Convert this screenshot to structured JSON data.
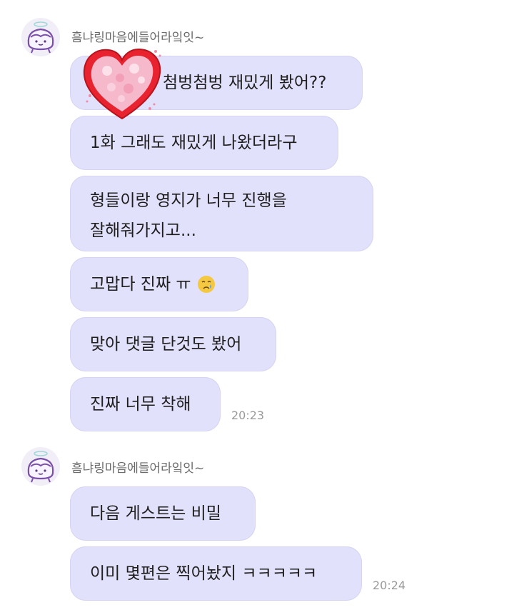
{
  "groups": [
    {
      "sender": "흠냐링마음에들어라잌잇~",
      "messages": [
        {
          "text": "첨벙첨벙 재밌게 봤어??"
        },
        {
          "text": "1화 그래도 재밌게 나왔더라구"
        },
        {
          "lines": [
            "형들이랑 영지가 너무 진행을",
            "잘해줘가지고..."
          ]
        },
        {
          "text": "고맙다 진짜 ㅠ",
          "emoji": "crying-face-icon"
        },
        {
          "text": "맞아 댓글 단것도 봤어"
        },
        {
          "text": "진짜 너무 착해"
        }
      ],
      "time": "20:23"
    },
    {
      "sender": "흠냐링마음에들어라잌잇~",
      "messages": [
        {
          "text": "다음 게스트는 비밀"
        },
        {
          "text": "이미 몇편은 찍어놨지 ㅋㅋㅋㅋㅋ"
        }
      ],
      "time": "20:24"
    }
  ],
  "colors": {
    "bubble": "#e2e1fb",
    "timestamp": "#9a9a9a",
    "sender": "#6b6b6b",
    "heart": "#e8222e"
  },
  "icons": {
    "sticker": "heart-sticker-icon",
    "avatar": "pudding-avatar-icon"
  }
}
